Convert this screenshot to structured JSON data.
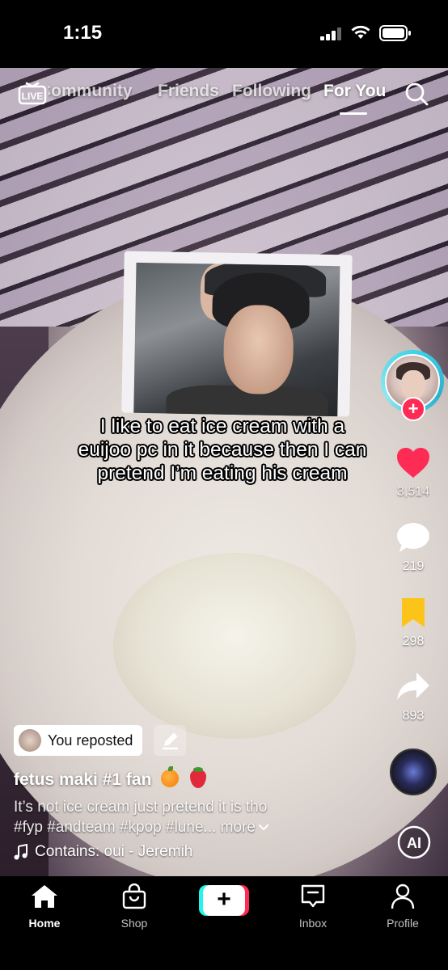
{
  "status_bar": {
    "time": "1:15"
  },
  "top_nav": {
    "live_label": "LIVE",
    "tabs": [
      {
        "label": "Community"
      },
      {
        "label": "Friends"
      },
      {
        "label": "Following"
      },
      {
        "label": "For You",
        "active": true
      }
    ]
  },
  "video": {
    "overlay_caption": "I like to eat ice cream with a euijoo pc in it because then I can pretend I’m eating his cream"
  },
  "actions": {
    "likes": "3,514",
    "comments": "219",
    "saves": "298",
    "shares": "893",
    "ai_label": "AI"
  },
  "post": {
    "repost_label": "You reposted",
    "username": "fetus maki #1 fan",
    "description_line1": "It’s not ice cream just pretend it is tho",
    "description_line2": "#fyp #andteam #kpop #lune...",
    "more_label": "more",
    "sound": "Contains: oui - Jeremih"
  },
  "tab_bar": {
    "items": [
      {
        "label": "Home",
        "icon": "home-icon",
        "active": true
      },
      {
        "label": "Shop",
        "icon": "shop-icon"
      },
      {
        "label": "Inbox",
        "icon": "inbox-icon"
      },
      {
        "label": "Profile",
        "icon": "profile-icon"
      }
    ],
    "create_label": "+"
  },
  "colors": {
    "like_red": "#fe2c55",
    "save_yellow": "#fcc419",
    "avatar_ring": "#3fd4e8"
  }
}
